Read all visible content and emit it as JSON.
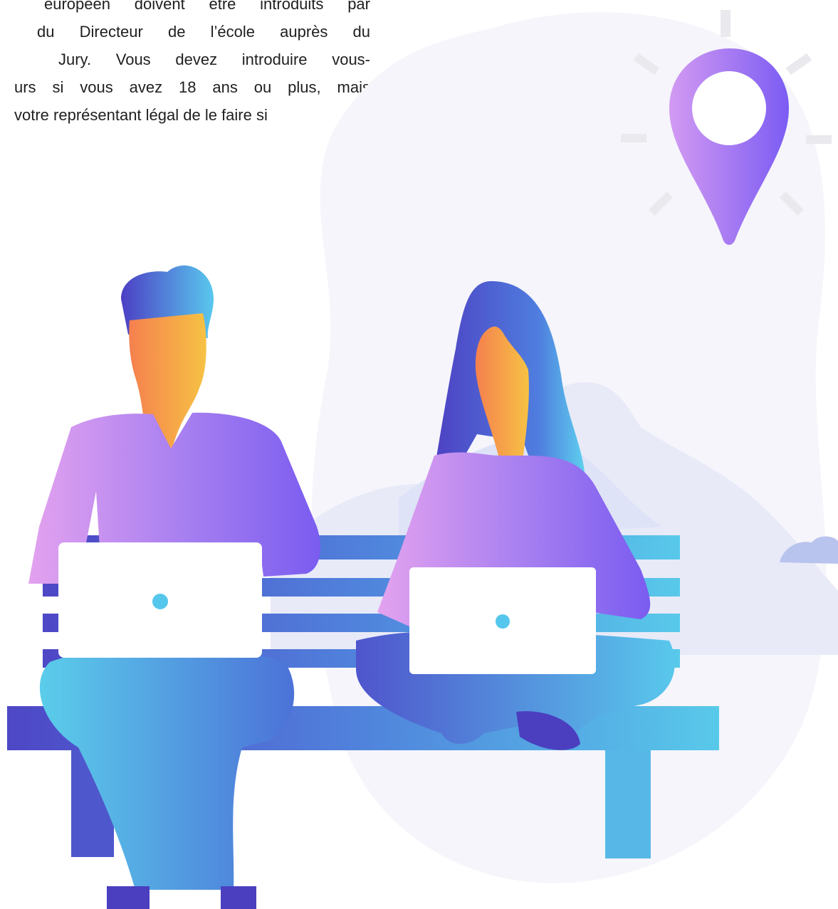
{
  "paragraph": {
    "lines": [
      "européen doivent être introduits par",
      "du Directeur de l’école auprès du",
      "Jury. Vous devez introduire vous-",
      "urs si vous avez 18 ans ou plus, mais",
      "votre représentant légal de le faire si"
    ]
  },
  "colors": {
    "purple": "#9b6cf0",
    "violet": "#7f5af0",
    "pink_purple": "#d99ef0",
    "indigo": "#4c45c8",
    "blue": "#4f7ee0",
    "cyan": "#57c6ec",
    "orange": "#f6914a",
    "yellow": "#f5c04a",
    "bg_blob": "#f4f4fb",
    "hill": "#e7e9f8"
  },
  "icons": [
    "location-pin-icon",
    "laptop-icon"
  ]
}
